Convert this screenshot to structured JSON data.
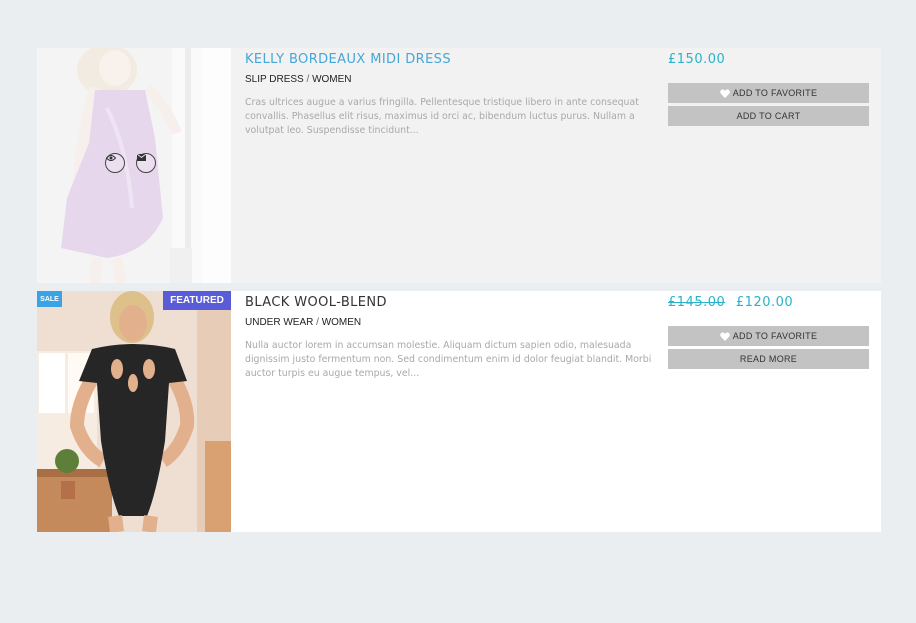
{
  "products": [
    {
      "title": "KELLY BORDEAUX MIDI DRESS",
      "category": "SLIP DRESS",
      "category_parent": "WOMEN",
      "separator": "/",
      "description": "Cras ultrices augue a varius fringilla. Pellentesque tristique libero in ante consequat convallis. Phasellus elit risus, maximus id orci ac, bibendum luctus purus. Nullam a volutpat leo. Suspendisse tincidunt...",
      "price": "£150.00",
      "favorite_label": "ADD TO FAVORITE",
      "primary_action_label": "ADD TO CART",
      "quick_icons": [
        "eye-icon",
        "envelope-icon"
      ],
      "image_colors": {
        "garment": "#c9a6d8",
        "skin": "#ecdcd2"
      }
    },
    {
      "title": "BLACK WOOL-BLEND",
      "category": "UNDER WEAR",
      "category_parent": "WOMEN",
      "separator": "/",
      "description": "Nulla auctor lorem in accumsan molestie. Aliquam dictum sapien odio, malesuada dignissim justo fermentum non. Sed condimentum enim id dolor feugiat blandit. Morbi auctor turpis eu augue tempus, vel...",
      "price_old": "£145.00",
      "price": "£120.00",
      "badge_sale": "SALE",
      "badge_featured": "FEATURED",
      "favorite_label": "ADD TO FAVORITE",
      "primary_action_label": "READ MORE",
      "image_colors": {
        "garment": "#262626",
        "skin": "#e3b08d"
      }
    }
  ],
  "colors": {
    "page_bg": "#ebeef1",
    "title_link": "#45a7d8",
    "price": "#29b3c9",
    "button_bg": "#c3c3c3",
    "badge_sale": "#3aa3e3",
    "badge_featured": "#5a5bd6"
  }
}
